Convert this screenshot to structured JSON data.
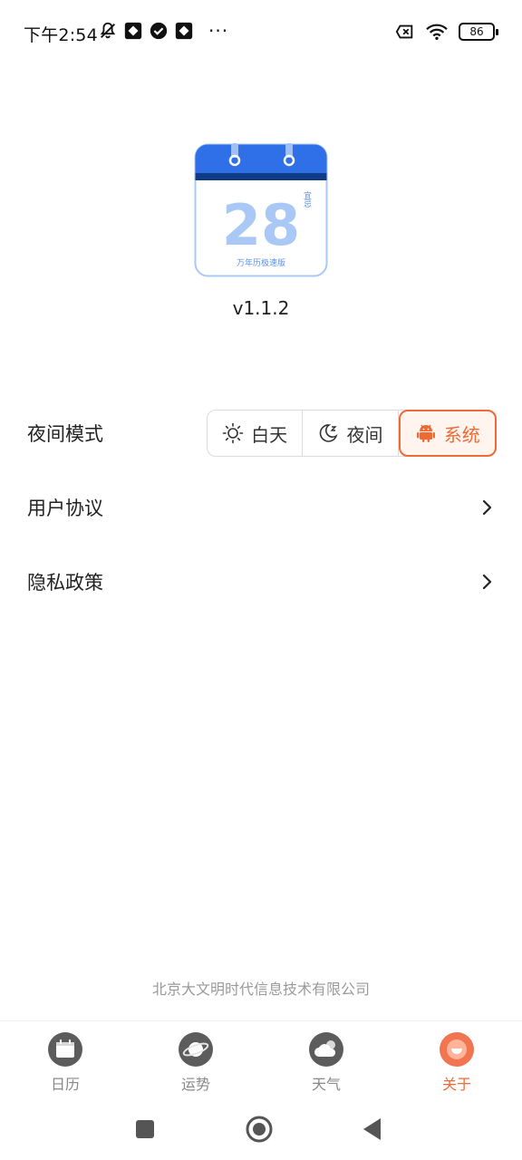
{
  "status_bar": {
    "time": "下午2:54",
    "more": "···",
    "battery": "86"
  },
  "app": {
    "logo_day": "28",
    "logo_tag": "宜忌",
    "logo_caption": "万年历极速版",
    "version": "v1.1.2"
  },
  "settings": {
    "night_mode": {
      "label": "夜间模式",
      "options": [
        {
          "label": "白天",
          "icon": "sun-icon"
        },
        {
          "label": "夜间",
          "icon": "moon-icon"
        },
        {
          "label": "系统",
          "icon": "android-icon"
        }
      ],
      "selected": "系统"
    },
    "user_agreement": {
      "label": "用户协议"
    },
    "privacy_policy": {
      "label": "隐私政策"
    }
  },
  "footer": {
    "company": "北京大文明时代信息技术有限公司"
  },
  "bottom_nav": {
    "items": [
      {
        "label": "日历",
        "icon": "calendar-icon"
      },
      {
        "label": "运势",
        "icon": "planet-icon"
      },
      {
        "label": "天气",
        "icon": "cloud-icon"
      },
      {
        "label": "关于",
        "icon": "about-icon"
      }
    ],
    "active": "关于"
  },
  "colors": {
    "accent": "#ee6a35",
    "logo_blue": "#2f6fe8",
    "logo_light_blue": "#a9c8f5"
  }
}
